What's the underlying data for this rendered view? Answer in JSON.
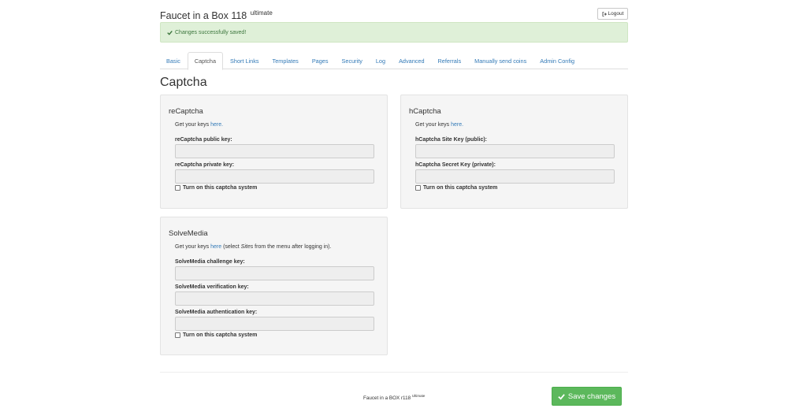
{
  "header": {
    "title": "Faucet in a Box 118",
    "title_sup": "ultimate",
    "logout_label": "Logout"
  },
  "alert": {
    "message": "Changes successfully saved!"
  },
  "tabs": [
    {
      "label": "Basic",
      "active": false
    },
    {
      "label": "Captcha",
      "active": true
    },
    {
      "label": "Short Links",
      "active": false
    },
    {
      "label": "Templates",
      "active": false
    },
    {
      "label": "Pages",
      "active": false
    },
    {
      "label": "Security",
      "active": false
    },
    {
      "label": "Log",
      "active": false
    },
    {
      "label": "Advanced",
      "active": false
    },
    {
      "label": "Referrals",
      "active": false
    },
    {
      "label": "Manually send coins",
      "active": false
    },
    {
      "label": "Admin Config",
      "active": false
    }
  ],
  "page": {
    "title": "Captcha"
  },
  "recaptcha": {
    "title": "reCaptcha",
    "desc_prefix": "Get your keys ",
    "desc_link": "here.",
    "public_key_label": "reCaptcha public key:",
    "public_key_value": "",
    "private_key_label": "reCaptcha private key:",
    "private_key_value": "",
    "toggle_label": "Turn on this captcha system",
    "enabled": false
  },
  "hcaptcha": {
    "title": "hCaptcha",
    "desc_prefix": "Get your keys ",
    "desc_link": "here.",
    "site_key_label": "hCaptcha Site Key (public):",
    "site_key_value": "",
    "secret_key_label": "hCaptcha Secret Key (private):",
    "secret_key_value": "",
    "toggle_label": "Turn on this captcha system",
    "enabled": false
  },
  "solvemedia": {
    "title": "SolveMedia",
    "desc_prefix": "Get your keys ",
    "desc_link": "here",
    "desc_mid": " (select ",
    "desc_em": "Sites",
    "desc_suffix": " from the menu after logging in).",
    "challenge_key_label": "SolveMedia challenge key:",
    "challenge_key_value": "",
    "verification_key_label": "SolveMedia verification key:",
    "verification_key_value": "",
    "authentication_key_label": "SolveMedia authentication key:",
    "authentication_key_value": "",
    "toggle_label": "Turn on this captcha system",
    "enabled": false
  },
  "footer": {
    "text": "Faucet in a BOX r118",
    "text_sup": "Ultimate",
    "save_label": "Save changes"
  },
  "colors": {
    "link": "#337ab7",
    "success_bg": "#dff0d8",
    "success_text": "#3c763d",
    "save_button": "#5cb85c"
  },
  "icons": {
    "logout": "sign-out-icon",
    "alert": "check-icon",
    "save": "check-icon"
  }
}
